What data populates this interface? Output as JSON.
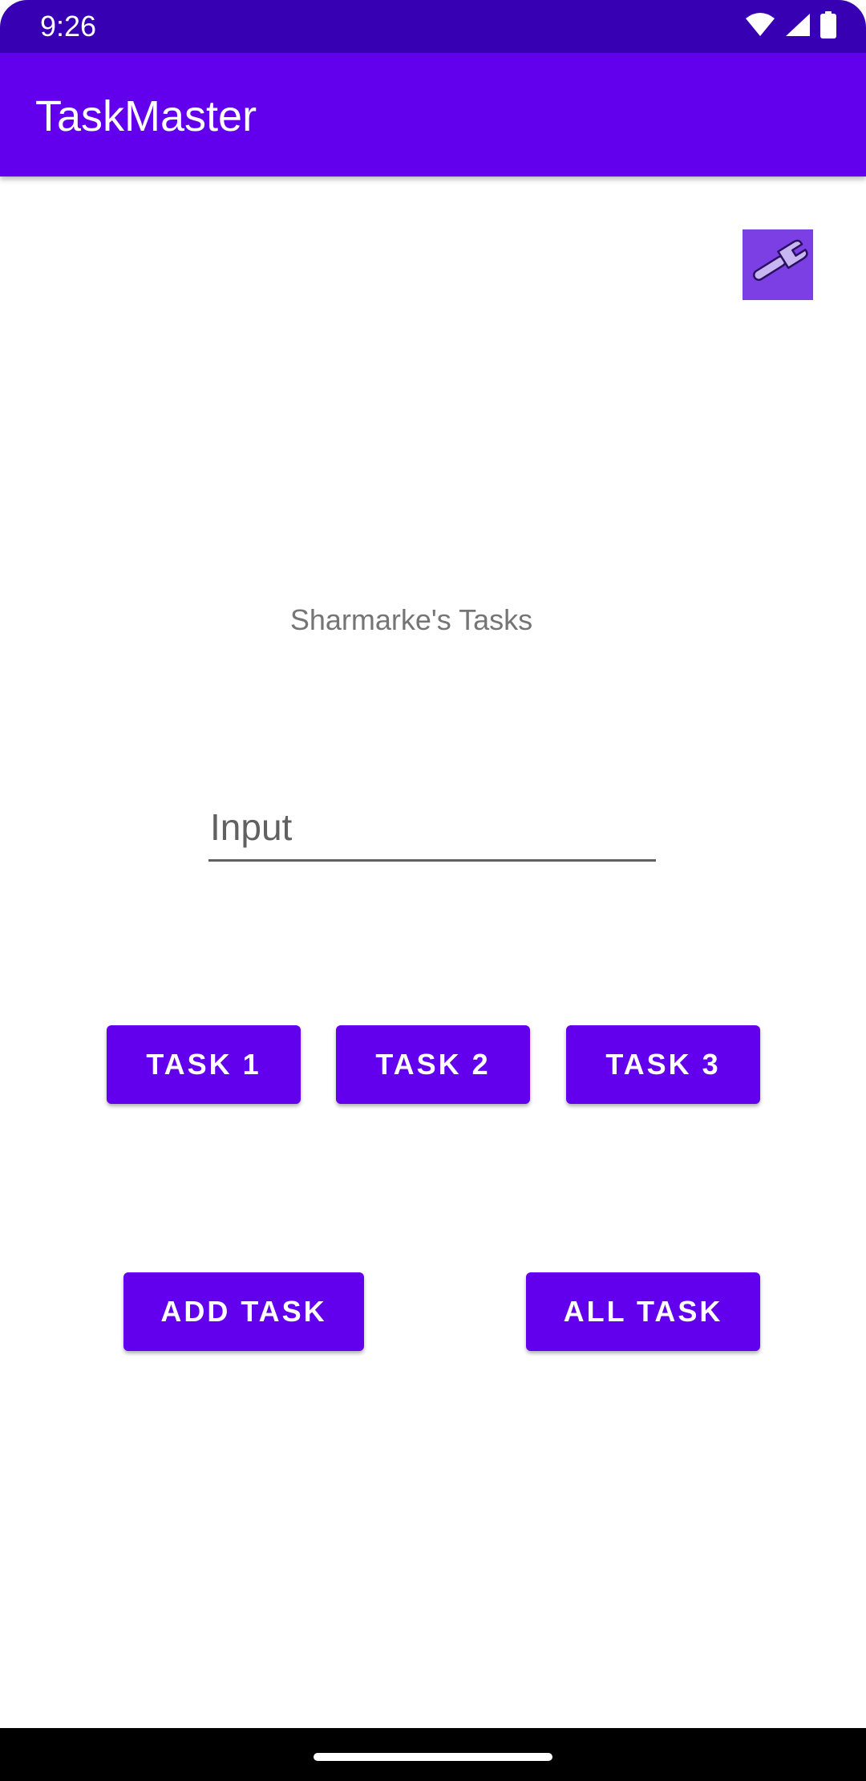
{
  "status_bar": {
    "time": "9:26",
    "icons": [
      "wifi-icon",
      "signal-icon",
      "battery-icon"
    ],
    "background": "#3700b3"
  },
  "app_bar": {
    "title": "TaskMaster",
    "background": "#6200ee"
  },
  "settings": {
    "icon": "wrench-icon",
    "background": "#7b3fe4"
  },
  "main": {
    "heading": "Sharmarke's Tasks",
    "input": {
      "value": "",
      "placeholder": "Input"
    },
    "task_buttons": [
      "TASK 1",
      "TASK 2",
      "TASK 3"
    ],
    "add_task_label": "ADD TASK",
    "all_task_label": "ALL TASK"
  },
  "colors": {
    "primary": "#6200ee",
    "primary_dark": "#3700b3",
    "on_primary": "#ffffff"
  }
}
